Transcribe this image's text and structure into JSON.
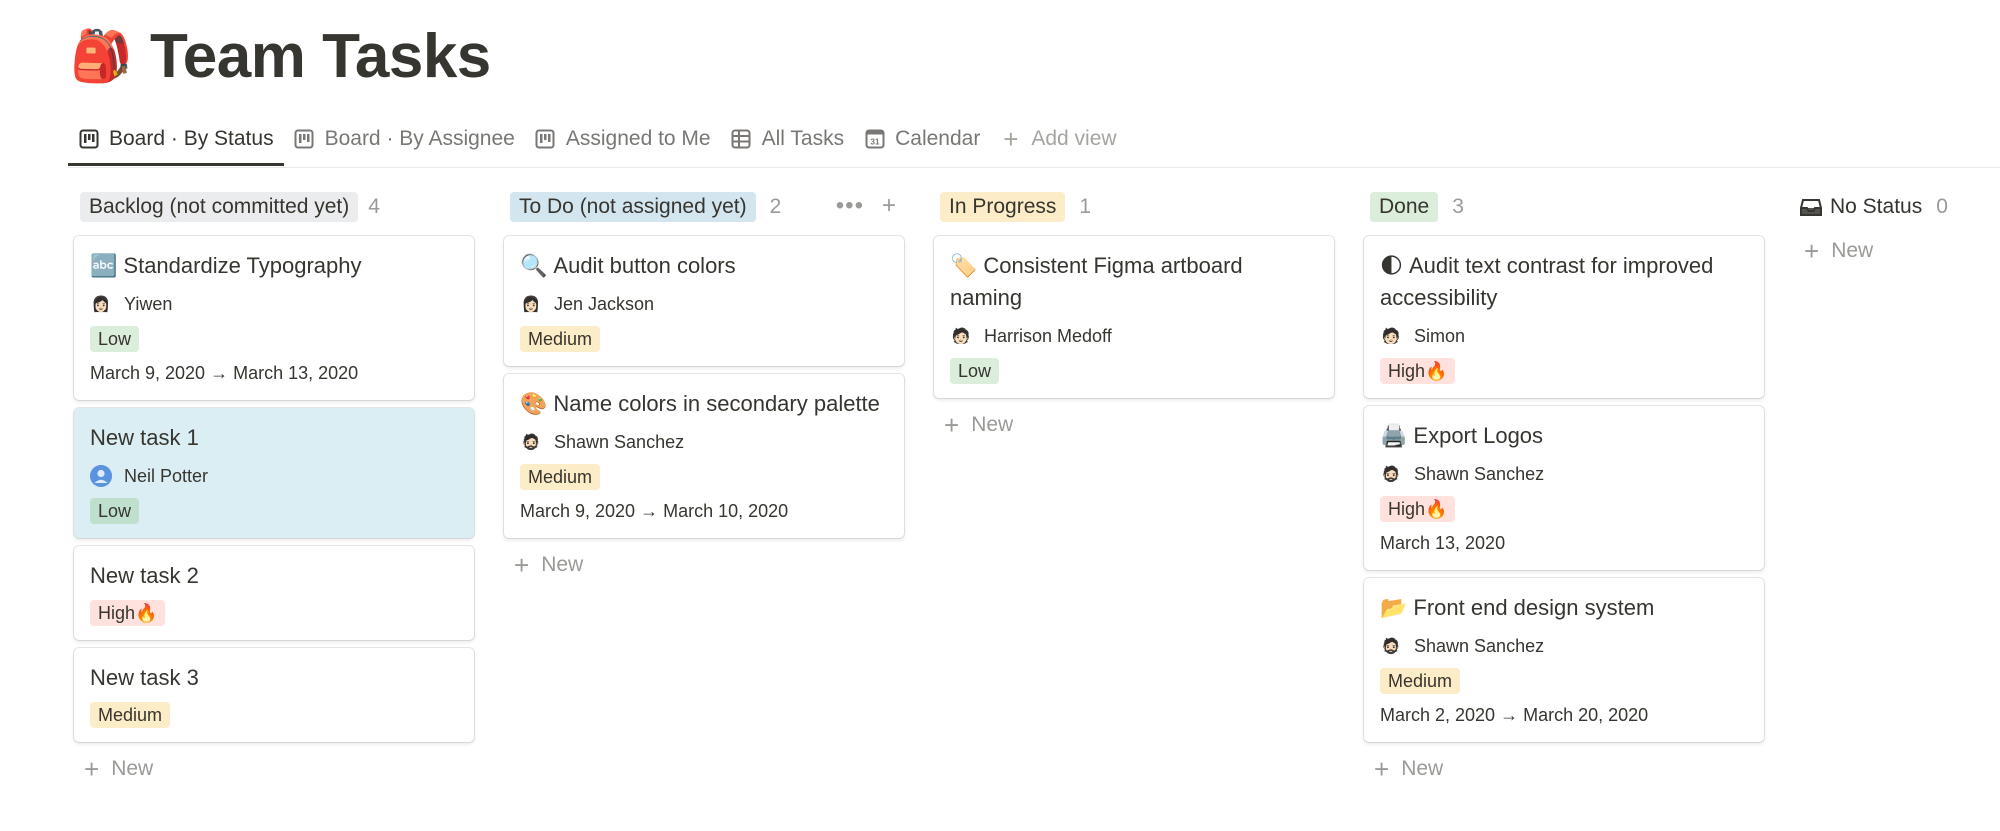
{
  "page": {
    "icon": "🎒",
    "title": "Team Tasks"
  },
  "tabs": [
    {
      "label": "Board · By Status",
      "icon": "board-icon",
      "active": true
    },
    {
      "label": "Board · By Assignee",
      "icon": "board-icon",
      "active": false
    },
    {
      "label": "Assigned to Me",
      "icon": "board-icon",
      "active": false
    },
    {
      "label": "All Tasks",
      "icon": "table-icon",
      "active": false
    },
    {
      "label": "Calendar",
      "icon": "calendar-icon",
      "active": false
    },
    {
      "label": "Add view",
      "icon": "plus-icon",
      "active": false
    }
  ],
  "colors": {
    "backlog": "#ebeced",
    "todo": "#d3e5ef",
    "inprogress": "#fdecc8",
    "done": "#dbeddb",
    "tag_low": "#dbeddb",
    "tag_medium": "#fdecc8",
    "tag_high": "#ffe2dd",
    "selected_card": "#dbeef4"
  },
  "columns": [
    {
      "name": "Backlog (not committed yet)",
      "count": "4",
      "cards": [
        {
          "icon": "🔤",
          "title": "Standardize Typography",
          "assignee": "Yiwen",
          "avatar": "👩🏻",
          "priority": "Low",
          "date": "March 9, 2020 → March 13, 2020"
        },
        {
          "icon": "",
          "title": "New task 1",
          "assignee": "Neil Potter",
          "avatar": "👤",
          "priority": "Low",
          "date": ""
        },
        {
          "icon": "",
          "title": "New task 2",
          "assignee": "",
          "avatar": "",
          "priority": "High🔥",
          "date": ""
        },
        {
          "icon": "",
          "title": "New task 3",
          "assignee": "",
          "avatar": "",
          "priority": "Medium",
          "date": ""
        }
      ],
      "new_label": "New"
    },
    {
      "name": "To Do (not assigned yet)",
      "count": "2",
      "cards": [
        {
          "icon": "🔍",
          "title": "Audit button colors",
          "assignee": "Jen Jackson",
          "avatar": "👩🏻",
          "priority": "Medium",
          "date": ""
        },
        {
          "icon": "🎨",
          "title": "Name colors in secondary palette",
          "assignee": "Shawn Sanchez",
          "avatar": "🧔🏻",
          "priority": "Medium",
          "date": "March 9, 2020 → March 10, 2020"
        }
      ],
      "new_label": "New"
    },
    {
      "name": "In Progress",
      "count": "1",
      "cards": [
        {
          "icon": "🏷️",
          "title": "Consistent Figma artboard naming",
          "assignee": "Harrison Medoff",
          "avatar": "🧑🏻",
          "priority": "Low",
          "date": ""
        }
      ],
      "new_label": "New"
    },
    {
      "name": "Done",
      "count": "3",
      "cards": [
        {
          "icon": "🌓",
          "title": "Audit text contrast for improved accessibility",
          "assignee": "Simon",
          "avatar": "🧑🏻",
          "priority": "High🔥",
          "date": ""
        },
        {
          "icon": "🖨️",
          "title": "Export Logos",
          "assignee": "Shawn Sanchez",
          "avatar": "🧔🏻",
          "priority": "High🔥",
          "date": "March 13, 2020"
        },
        {
          "icon": "📂",
          "title": "Front end design system",
          "assignee": "Shawn Sanchez",
          "avatar": "🧔🏻",
          "priority": "Medium",
          "date": "March 2, 2020 → March 20, 2020"
        }
      ],
      "new_label": "New"
    }
  ],
  "no_status": {
    "name": "No Status",
    "count": "0",
    "new_label": "New"
  }
}
